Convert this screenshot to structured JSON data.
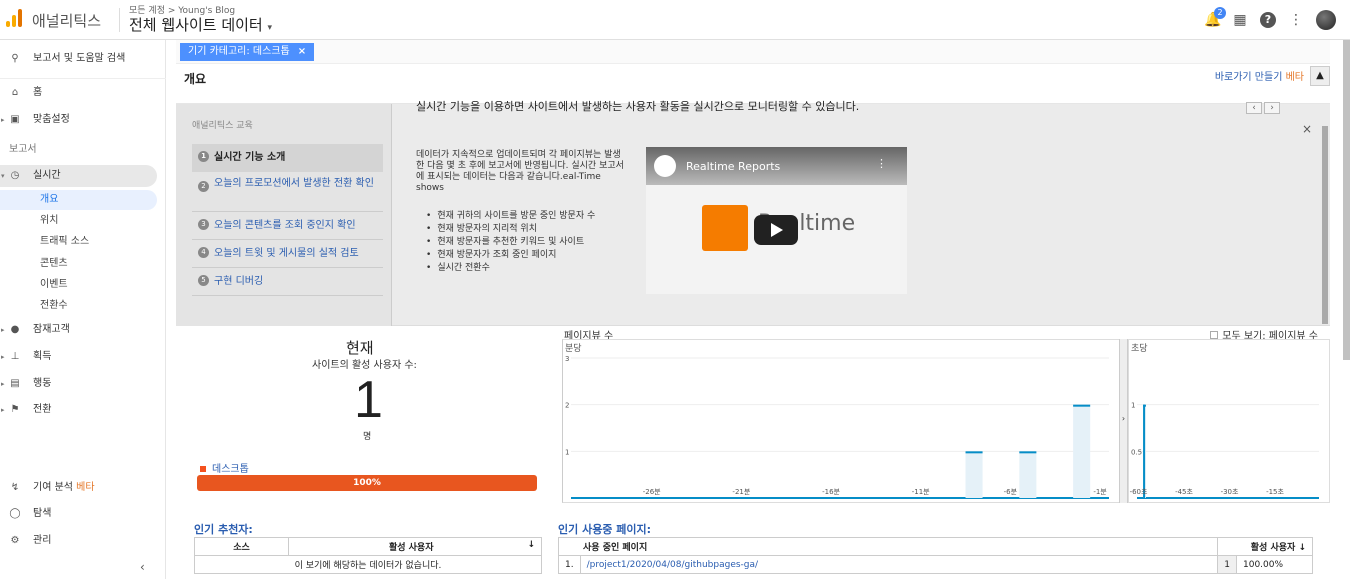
{
  "header": {
    "app_name": "애널리틱스",
    "account_crumb": "모든 계정 > Young's Blog",
    "view_name": "전체 웹사이트 데이터",
    "notification_count": "2"
  },
  "sidebar": {
    "search_label": "보고서 및 도움말 검색",
    "home": "홈",
    "customization": "맞춤설정",
    "reports_section": "보고서",
    "realtime": "실시간",
    "realtime_items": [
      "개요",
      "위치",
      "트래픽 소스",
      "콘텐츠",
      "이벤트",
      "전환수"
    ],
    "audience": "잠재고객",
    "acquisition": "획득",
    "behavior": "행동",
    "conversions": "전환",
    "attribution": "기여 분석",
    "attribution_badge": "베타",
    "discover": "탐색",
    "admin": "관리"
  },
  "filter": {
    "chip_label": "기기 카테고리: 데스크톱"
  },
  "titlebar": {
    "title": "개요",
    "shortcut": "바로가기 만들기",
    "shortcut_badge": "베타"
  },
  "edu": {
    "nav_title": "애널리틱스 교육",
    "items": [
      "실시간 기능 소개",
      "오늘의 프로모션에서 발생한 전환 확인",
      "오늘의 콘텐츠를 조회 중인지 확인",
      "오늘의 트윗 및 게시물의 실적 검토",
      "구현 디버깅"
    ],
    "headline": "실시간 기능을 이용하면 사이트에서 발생하는 사용자 활동을 실시간으로 모니터링할 수 있습니다.",
    "body": "데이터가 지속적으로 업데이트되며 각 페이지뷰는 발생한 다음 몇 초 후에 보고서에 반영됩니다. 실시간 보고서에 표시되는 데이터는 다음과 같습니다.eal-Time shows",
    "bullets": [
      "현재 귀하의 사이트를 방문 중인 방문자 수",
      "현재 방문자의 지리적 위치",
      "현재 방문자를 추천한 키워드 및 사이트",
      "현재 방문자가 조회 중인 페이지",
      "실시간 전환수"
    ],
    "video_title": "Realtime Reports",
    "video_word": "Realtime",
    "pager_prev": "‹",
    "pager_next": "›",
    "close": "×"
  },
  "now": {
    "title": "현재",
    "subtitle": "사이트의 활성 사용자 수:",
    "count": "1",
    "unit": "명",
    "device": "데스크톱",
    "device_pct": "100%"
  },
  "pageviews": {
    "title": "페이지뷰 수",
    "show_all": "모두 보기: 페이지뷰 수",
    "toggle": "›"
  },
  "chart_data": [
    {
      "type": "bar",
      "title": "분당",
      "ylim": [
        0,
        3
      ],
      "yticks": [
        "1",
        "2",
        "3"
      ],
      "xticks": [
        "-26분",
        "-21분",
        "-16분",
        "-11분",
        "-6분",
        "-1분"
      ],
      "x": [
        -30,
        -29,
        -28,
        -27,
        -26,
        -25,
        -24,
        -23,
        -22,
        -21,
        -20,
        -19,
        -18,
        -17,
        -16,
        -15,
        -14,
        -13,
        -12,
        -11,
        -10,
        -9,
        -8,
        -7,
        -6,
        -5,
        -4,
        -3,
        -2,
        -1
      ],
      "values": [
        0,
        0,
        0,
        0,
        0,
        0,
        0,
        0,
        0,
        0,
        0,
        0,
        0,
        0,
        0,
        0,
        0,
        0,
        0,
        0,
        0,
        0,
        1,
        0,
        0,
        1,
        0,
        0,
        2,
        0
      ]
    },
    {
      "type": "bar",
      "title": "초당",
      "ylim": [
        0,
        1.5
      ],
      "yticks": [
        "0.5",
        "1"
      ],
      "xticks": [
        "-60초",
        "-45초",
        "-30초",
        "-15초"
      ],
      "x": [
        -60,
        -59,
        -58,
        -57,
        -56,
        -55,
        -54,
        -53,
        -52,
        -51,
        -50,
        -49,
        -48,
        -47,
        -46,
        -45,
        -44,
        -43,
        -42,
        -41,
        -40,
        -39,
        -38,
        -37,
        -36,
        -35,
        -34,
        -33,
        -32,
        -31,
        -30,
        -29,
        -28,
        -27,
        -26,
        -25,
        -24,
        -23,
        -22,
        -21,
        -20,
        -19,
        -18,
        -17,
        -16,
        -15,
        -14,
        -13,
        -12,
        -11,
        -10,
        -9,
        -8,
        -7,
        -6,
        -5,
        -4,
        -3,
        -2,
        -1
      ],
      "values": [
        0,
        0,
        1,
        0,
        0,
        0,
        0,
        0,
        0,
        0,
        0,
        0,
        0,
        0,
        0,
        0,
        0,
        0,
        0,
        0,
        0,
        0,
        0,
        0,
        0,
        0,
        0,
        0,
        0,
        0,
        0,
        0,
        0,
        0,
        0,
        0,
        0,
        0,
        0,
        0,
        0,
        0,
        0,
        0,
        0,
        0,
        0,
        0,
        0,
        0,
        0,
        0,
        0,
        0,
        0,
        0,
        0,
        0,
        0,
        0
      ]
    }
  ],
  "referrers": {
    "title": "인기 추천자:",
    "col_source": "소스",
    "col_users": "활성 사용자",
    "empty": "이 보기에 해당하는 데이터가 없습니다."
  },
  "active_pages": {
    "title": "인기 사용중 페이지:",
    "col_page": "사용 중인 페이지",
    "col_users": "활성 사용자",
    "rows": [
      {
        "idx": "1.",
        "page": "/project1/2020/04/08/githubpages-ga/",
        "users": "1",
        "pct": "100.00%"
      }
    ]
  },
  "colors": {
    "accent": "#e8561f",
    "link": "#2a5db0",
    "chart": "#058dc7"
  }
}
